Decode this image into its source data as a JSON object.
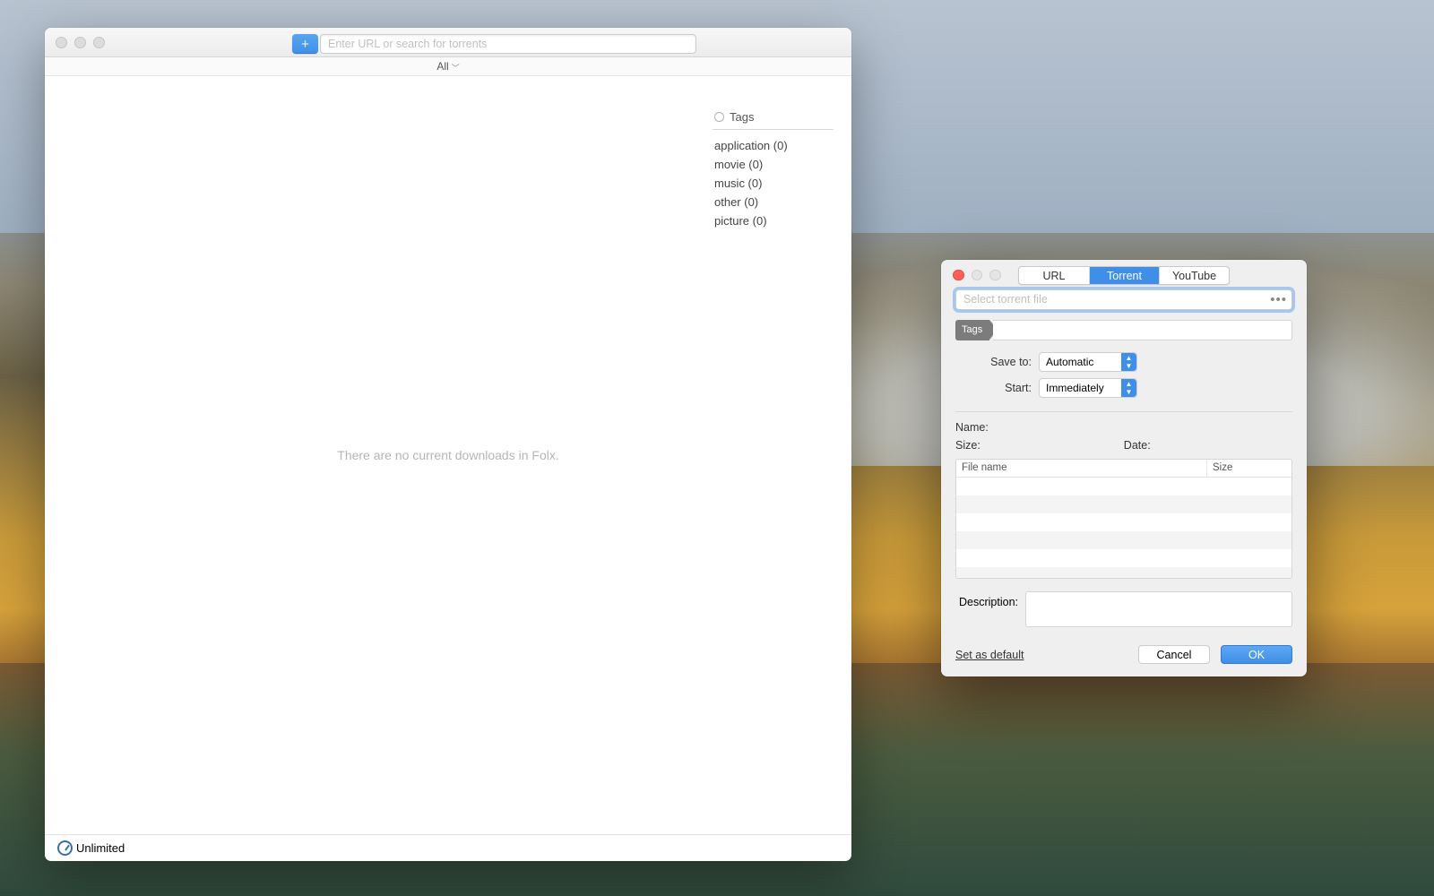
{
  "main": {
    "search_placeholder": "Enter URL or search for torrents",
    "add_glyph": "+",
    "filter_label": "All",
    "empty_message": "There are no current downloads in Folx.",
    "tags_header": "Tags",
    "tags": [
      {
        "label": "application (0)"
      },
      {
        "label": "movie (0)"
      },
      {
        "label": "music (0)"
      },
      {
        "label": "other (0)"
      },
      {
        "label": "picture (0)"
      }
    ],
    "status_speed": "Unlimited"
  },
  "dialog": {
    "tabs": {
      "url": "URL",
      "torrent": "Torrent",
      "youtube": "YouTube",
      "active": "torrent"
    },
    "torrent_placeholder": "Select torrent file",
    "tags_chip": "Tags",
    "save_to_label": "Save to:",
    "save_to_value": "Automatic",
    "start_label": "Start:",
    "start_value": "Immediately",
    "name_label": "Name:",
    "size_label": "Size:",
    "date_label": "Date:",
    "table": {
      "col_name": "File name",
      "col_size": "Size"
    },
    "description_label": "Description:",
    "set_default": "Set as default",
    "cancel": "Cancel",
    "ok": "OK"
  }
}
